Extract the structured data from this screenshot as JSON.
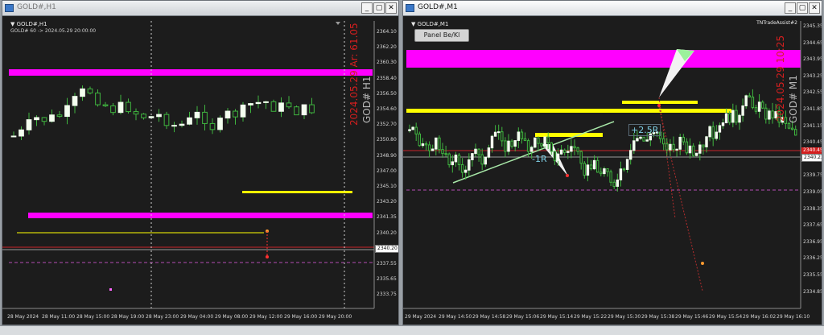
{
  "left": {
    "window_title": "GOLD#,H1",
    "chart_title": "▼ GOLD#,H1",
    "info_line": "GOLD# 60 -> 2024.05.29 20:00:00",
    "overlay_red": "2024.05.29 Ar: 61.05",
    "overlay_gray": "GOD# H1",
    "price_axis": [
      "2364.10",
      "2362.20",
      "2360.30",
      "2358.40",
      "2356.50",
      "2354.60",
      "2352.70",
      "2350.80",
      "2348.90",
      "2347.00",
      "2345.10",
      "2343.20",
      "2341.35",
      "2340.20",
      "2339.45",
      "2337.55",
      "2335.65",
      "2333.75"
    ],
    "price_tag": "2340.20",
    "time_axis": [
      "28 May 2024",
      "28 May 11:00",
      "28 May 15:00",
      "28 May 19:00",
      "28 May 23:00",
      "29 May 04:00",
      "29 May 08:00",
      "29 May 12:00",
      "29 May 16:00",
      "29 May 20:00"
    ]
  },
  "right": {
    "window_title": "GOLD#,M1",
    "chart_title": "▼ GOLD#,M1",
    "indicator_name": "TNTradeAssist#2",
    "panel_button": "Panel Be/Kl",
    "overlay_red": "2024.05.29 10:25",
    "overlay_gray": "GOD# M1",
    "label_loss": "-1R",
    "label_gain": "+2.5R",
    "price_axis": [
      "2345.35",
      "2344.65",
      "2343.95",
      "2343.25",
      "2342.55",
      "2341.85",
      "2341.15",
      "2340.45",
      "2340.23",
      "2339.75",
      "2339.05",
      "2338.35",
      "2337.65",
      "2336.95",
      "2336.25",
      "2335.55",
      "2334.85"
    ],
    "price_tag_red": "2340.45",
    "price_tag_white": "2340.23",
    "time_axis": [
      "29 May 2024",
      "29 May 14:50",
      "29 May 14:58",
      "29 May 15:06",
      "29 May 15:14",
      "29 May 15:22",
      "29 May 15:30",
      "29 May 15:38",
      "29 May 15:46",
      "29 May 15:54",
      "29 May 16:02",
      "29 May 16:10"
    ]
  },
  "colors": {
    "magenta": "#ff00ff",
    "yellow": "#ffff00",
    "bull": "#f4fff0",
    "bear_wick": "#3fb53f",
    "price_red": "#d41f1f"
  }
}
